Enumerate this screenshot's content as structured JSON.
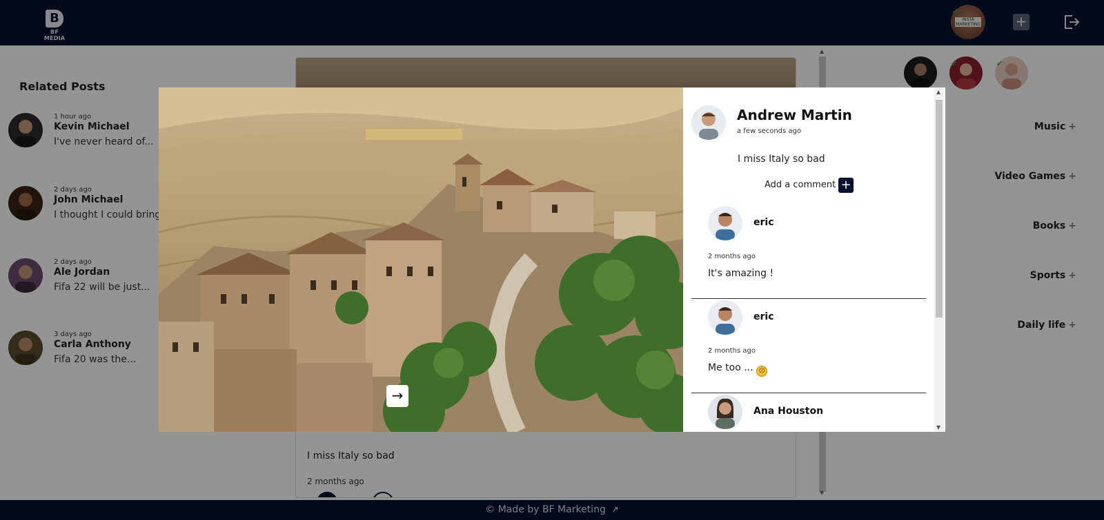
{
  "header": {
    "logo_text": "BF MEDIA",
    "logo_letter": "B",
    "avatar_tag": "INSTA MARKETING",
    "add_post_icon": "plus-icon",
    "logout_icon": "logout-icon"
  },
  "sidebar": {
    "title": "Related Posts",
    "items": [
      {
        "time": "1 hour ago",
        "name": "Kevin Michael",
        "text": "I've never heard of..."
      },
      {
        "time": "2 days ago",
        "name": "John Michael",
        "text": "I thought I could bring..."
      },
      {
        "time": "2 days ago",
        "name": "Ale Jordan",
        "text": "Fifa 22 will be just..."
      },
      {
        "time": "3 days ago",
        "name": "Carla Anthony",
        "text": "Fifa 20 was the..."
      }
    ]
  },
  "feed": {
    "text": "I miss Italy so bad",
    "time": "2 months ago"
  },
  "categories": [
    {
      "label": "Music",
      "plus": "+"
    },
    {
      "label": "Video Games",
      "plus": "+"
    },
    {
      "label": "Books",
      "plus": "+"
    },
    {
      "label": "Sports",
      "plus": "+"
    },
    {
      "label": "Daily life",
      "plus": "+"
    }
  ],
  "modal": {
    "author": "Andrew Martin",
    "author_time": "a few seconds ago",
    "post_text": "I miss Italy so bad",
    "add_comment_label": "Add a comment",
    "add_comment_button": "+",
    "next_button": "→",
    "comments": [
      {
        "name": "eric",
        "time": "2 months ago",
        "text": "It's amazing !"
      },
      {
        "name": "eric",
        "time": "2 months ago",
        "text": "Me too ..."
      },
      {
        "name": "Ana Houston",
        "time": "",
        "text": ""
      }
    ]
  },
  "footer": {
    "text": "© Made by BF Marketing",
    "ext_icon": "external-link-icon"
  },
  "colors": {
    "navy": "#061230",
    "overlay": "rgba(0,0,0,0.42)"
  }
}
